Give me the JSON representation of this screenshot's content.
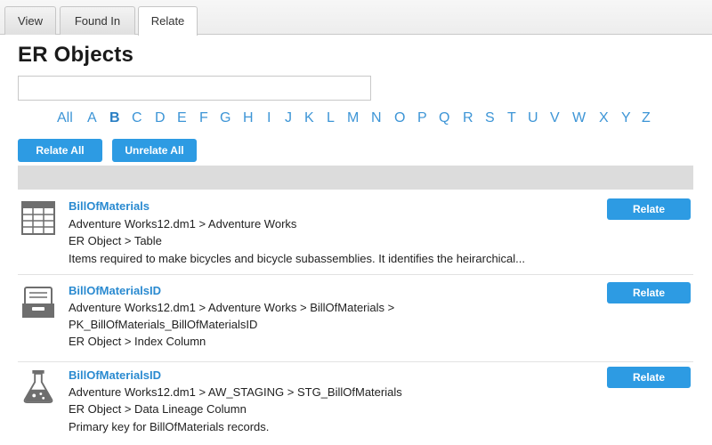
{
  "tabs": [
    "View",
    "Found In",
    "Relate"
  ],
  "active_tab": "Relate",
  "page_title": "ER Objects",
  "search": {
    "value": "",
    "placeholder": ""
  },
  "alphabet": [
    "All",
    "A",
    "B",
    "C",
    "D",
    "E",
    "F",
    "G",
    "H",
    "I",
    "J",
    "K",
    "L",
    "M",
    "N",
    "O",
    "P",
    "Q",
    "R",
    "S",
    "T",
    "U",
    "V",
    "W",
    "X",
    "Y",
    "Z"
  ],
  "alphabet_selected": "B",
  "actions": {
    "relate_all": "Relate All",
    "unrelate_all": "Unrelate All"
  },
  "results": [
    {
      "icon": "table-icon",
      "name": "BillOfMaterials",
      "path": "Adventure Works12.dm1 > Adventure Works",
      "type": "ER Object > Table",
      "description": "Items required to make bicycles and bicycle subassemblies. It identifies the heirarchical...",
      "button": "Relate"
    },
    {
      "icon": "index-icon",
      "name": "BillOfMaterialsID",
      "path": "Adventure Works12.dm1 > Adventure Works > BillOfMaterials >",
      "path_cont": "PK_BillOfMaterials_BillOfMaterialsID",
      "type": "ER Object > Index Column",
      "button": "Relate"
    },
    {
      "icon": "flask-icon",
      "name": "BillOfMaterialsID",
      "path": "Adventure Works12.dm1 > AW_STAGING > STG_BillOfMaterials",
      "type": "ER Object > Data Lineage Column",
      "description": "Primary key for BillOfMaterials records.",
      "button": "Relate"
    }
  ],
  "colors": {
    "accent": "#2d9be3",
    "link": "#2a8ad0",
    "alpha_link": "#3d95d6",
    "band": "#dcdcdc"
  }
}
